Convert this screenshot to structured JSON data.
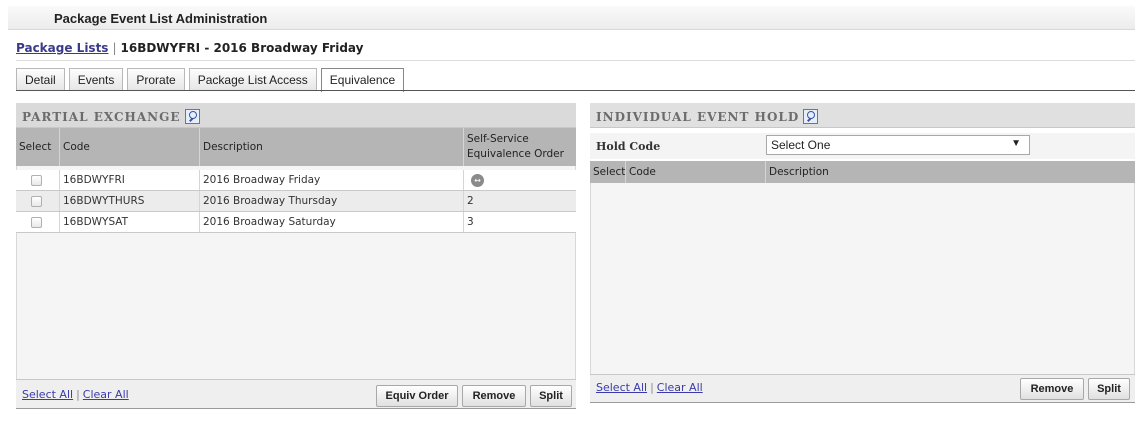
{
  "page": {
    "title": "Package Event List Administration"
  },
  "breadcrumb": {
    "link": "Package Lists",
    "separator": "|",
    "current": "16BDWYFRI - 2016 Broadway Friday"
  },
  "tabs": [
    "Detail",
    "Events",
    "Prorate",
    "Package List Access",
    "Equivalence"
  ],
  "active_tab": "Equivalence",
  "partial_exchange": {
    "title": "PARTIAL EXCHANGE",
    "columns": {
      "select": "Select",
      "code": "Code",
      "description": "Description",
      "order_line1": "Self-Service",
      "order_line2": "Equivalence Order"
    },
    "rows": [
      {
        "code": "16BDWYFRI",
        "description": "2016 Broadway Friday",
        "order": ""
      },
      {
        "code": "16BDWYTHURS",
        "description": "2016 Broadway Thursday",
        "order": "2"
      },
      {
        "code": "16BDWYSAT",
        "description": "2016 Broadway Saturday",
        "order": "3"
      }
    ],
    "order_icon": "reorder-icon",
    "footer": {
      "select_all": "Select All",
      "clear_all": "Clear All",
      "equiv_order": "Equiv Order",
      "remove": "Remove",
      "split": "Split"
    }
  },
  "individual_hold": {
    "title": "INDIVIDUAL EVENT HOLD",
    "hold_code_label": "Hold Code",
    "hold_code_value": "Select One",
    "columns": {
      "select": "Select",
      "code": "Code",
      "description": "Description"
    },
    "footer": {
      "select_all": "Select All",
      "clear_all": "Clear All",
      "remove": "Remove",
      "split": "Split"
    }
  },
  "colors": {
    "panel_header": "#dadada",
    "grid_header": "#b5b5b5",
    "link": "#3a3aaa"
  }
}
